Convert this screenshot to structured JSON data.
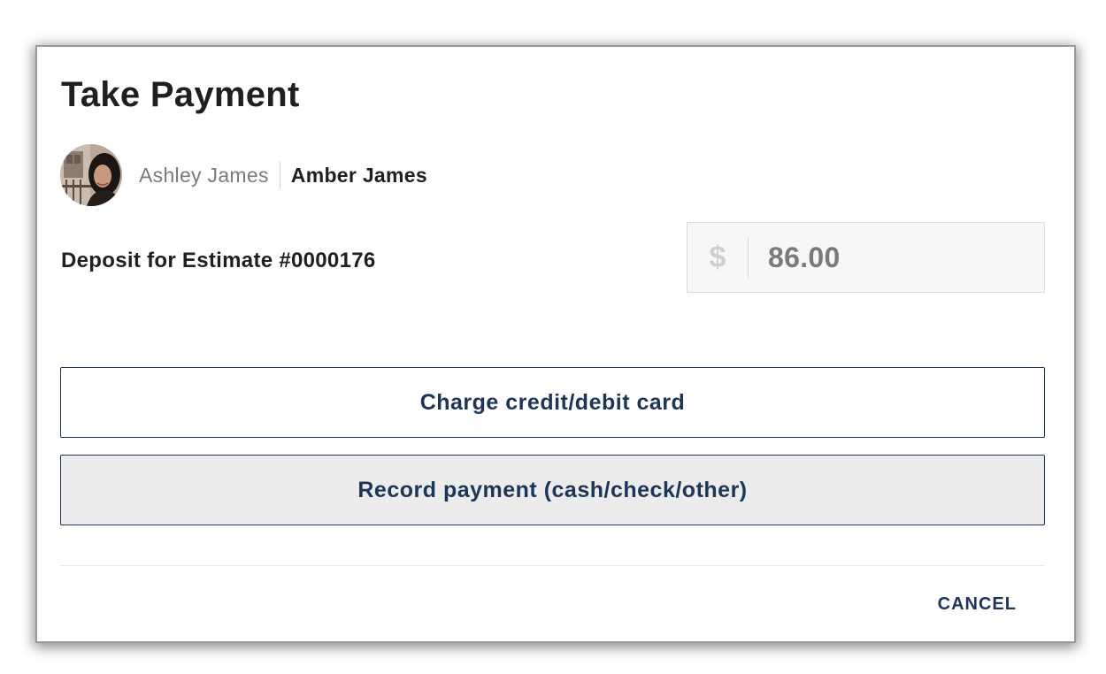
{
  "dialog": {
    "title": "Take Payment"
  },
  "customer": {
    "avatar_icon": "person-photo-avatar",
    "secondary_name": "Ashley James",
    "primary_name": "Amber James"
  },
  "payment": {
    "description": "Deposit for Estimate #0000176",
    "currency_symbol": "$",
    "amount": "86.00"
  },
  "actions": {
    "charge_card_label": "Charge credit/debit card",
    "record_payment_label": "Record payment (cash/check/other)",
    "cancel_label": "CANCEL"
  },
  "colors": {
    "accent": "#1d3557",
    "record_button_bg": "#ececec",
    "amount_box_bg": "#f7f7f7"
  }
}
